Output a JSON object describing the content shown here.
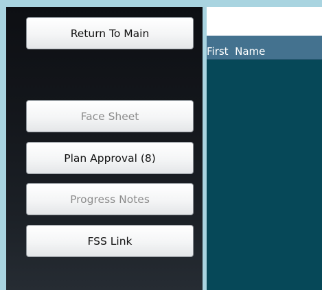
{
  "sidebar": {
    "buttons": {
      "return_to_main": {
        "label": "Return To Main",
        "enabled": true
      },
      "face_sheet": {
        "label": "Face Sheet",
        "enabled": false
      },
      "plan_approval": {
        "label": "Plan Approval (8)",
        "enabled": true
      },
      "progress_notes": {
        "label": "Progress Notes",
        "enabled": false
      },
      "fss_link": {
        "label": "FSS Link",
        "enabled": true
      }
    }
  },
  "grid": {
    "columns": [
      {
        "header": "First  Name"
      }
    ],
    "rows": []
  },
  "colors": {
    "page_background": "#a9d4e0",
    "sidebar_background": "#14171c",
    "grid_background": "#064858",
    "grid_header": "#44728f",
    "disabled_text": "#8c8c8c"
  }
}
